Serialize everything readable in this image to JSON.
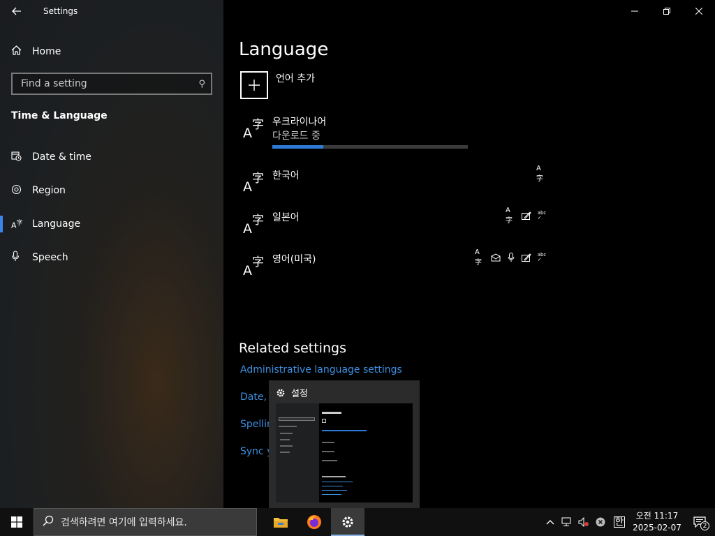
{
  "window": {
    "title": "Settings"
  },
  "sidebar": {
    "home_label": "Home",
    "search_placeholder": "Find a setting",
    "section_title": "Time & Language",
    "items": [
      {
        "label": "Date & time",
        "icon": "calendar-clock-icon"
      },
      {
        "label": "Region",
        "icon": "globe-icon"
      },
      {
        "label": "Language",
        "icon": "language-icon",
        "active": true
      },
      {
        "label": "Speech",
        "icon": "microphone-icon"
      }
    ]
  },
  "main": {
    "title": "Language",
    "add_language_label": "언어 추가",
    "languages": [
      {
        "name": "우크라이나어",
        "status": "다운로드 중",
        "progress": 0.26,
        "features": []
      },
      {
        "name": "한국어",
        "features": [
          "display-language-icon"
        ]
      },
      {
        "name": "일본어",
        "features": [
          "display-language-icon",
          "handwriting-icon",
          "spelling-icon"
        ]
      },
      {
        "name": "영어(미국)",
        "features": [
          "display-language-icon",
          "text-to-speech-icon",
          "speech-recognition-icon",
          "handwriting-icon",
          "spelling-icon"
        ]
      }
    ],
    "related_title": "Related settings",
    "related_links": [
      "Administrative language settings",
      "Date, t",
      "Spellin",
      "Sync y"
    ]
  },
  "thumbnail": {
    "title": "설정"
  },
  "taskbar": {
    "search_placeholder": "검색하려면 여기에 입력하세요.",
    "time": "오전 11:17",
    "date": "2025-02-07",
    "ime": "한",
    "notification_count": "2"
  },
  "colors": {
    "accent": "#3a86e8",
    "link": "#3d8fe0",
    "progress": "#2d7ad6"
  }
}
